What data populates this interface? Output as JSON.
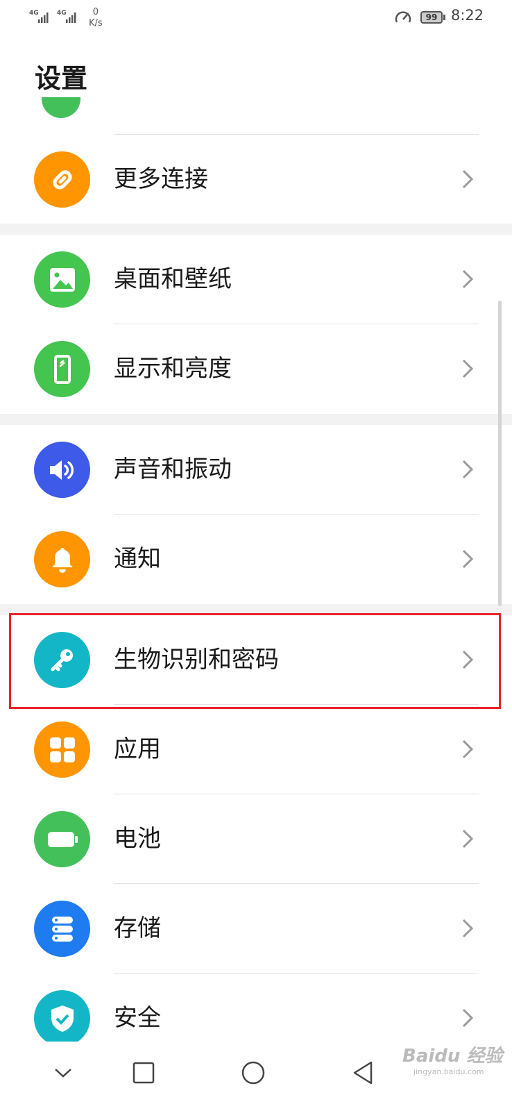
{
  "status_bar": {
    "network_1": "4G",
    "network_2": "4G",
    "speed_value": "0",
    "speed_unit": "K/s",
    "battery": "99",
    "time": "8:22"
  },
  "page": {
    "title": "设置"
  },
  "items": [
    {
      "label": "更多连接",
      "icon": "link-icon",
      "color": "#ff9500"
    },
    {
      "label": "桌面和壁纸",
      "icon": "image-icon",
      "color": "#43c54f"
    },
    {
      "label": "显示和亮度",
      "icon": "phone-display-icon",
      "color": "#43c54f"
    },
    {
      "label": "声音和振动",
      "icon": "speaker-icon",
      "color": "#3d5ae8"
    },
    {
      "label": "通知",
      "icon": "bell-icon",
      "color": "#ff9500"
    },
    {
      "label": "生物识别和密码",
      "icon": "key-icon",
      "color": "#13b6c6"
    },
    {
      "label": "应用",
      "icon": "apps-grid-icon",
      "color": "#ff9500"
    },
    {
      "label": "电池",
      "icon": "battery-icon",
      "color": "#43c05a"
    },
    {
      "label": "存储",
      "icon": "storage-icon",
      "color": "#1e7cf0"
    },
    {
      "label": "安全",
      "icon": "shield-icon",
      "color": "#13b6c6"
    }
  ],
  "highlight_color": "#e8232a",
  "watermark": {
    "brand": "Baidu 经验",
    "url": "jingyan.baidu.com"
  }
}
